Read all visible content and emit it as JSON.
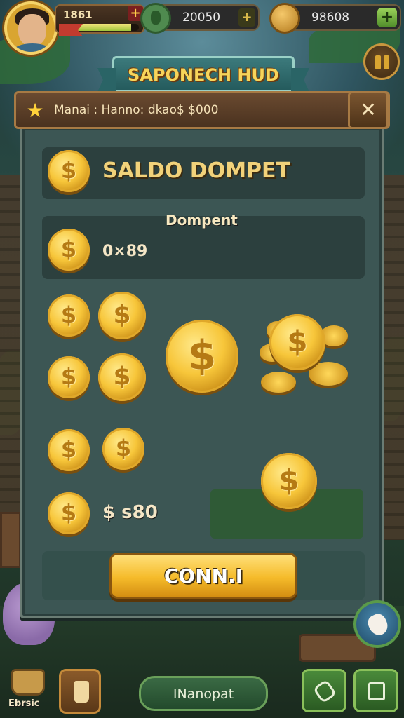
{
  "hud": {
    "player_level": "1861",
    "xp_progress": 0.9,
    "currency_primary": "20050",
    "currency_primary_add": "+",
    "currency_coins": "98608",
    "currency_coins_add": "+"
  },
  "title_banner": "SAPONECH HUD",
  "panel": {
    "header_text": "Manai : Hanno: dkao$  $000",
    "close_label": "✕",
    "saldo_label": "SALDO DOMPET",
    "dompet_label": "Dompent",
    "balance_value": "0×89",
    "amount_value": "$ s80",
    "confirm_label": "CONN.I"
  },
  "bottom_bar": {
    "bucket_label": "Ebrsic",
    "nav_label": "INanopat"
  },
  "icons": {
    "gem": "gem-icon",
    "coin": "coin-icon",
    "pause": "pause-icon",
    "star": "star-icon",
    "close": "close-icon",
    "hand": "hand-pointer-icon",
    "bag": "bag-icon",
    "tool": "tool-icon",
    "inventory": "inventory-icon"
  },
  "colors": {
    "panel_bg": "#3c5654",
    "gold": "#f7c63a",
    "header_wood": "#6a4a30",
    "accent_green": "#4a8a3a"
  }
}
